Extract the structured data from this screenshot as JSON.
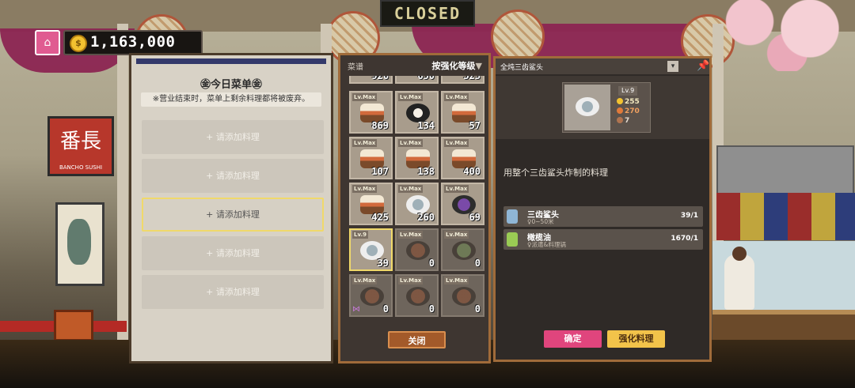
{
  "sign": {
    "text": "CLOSED"
  },
  "shop_sign": {
    "main": "番長",
    "sub": "BANCHO SUSHI"
  },
  "currency": {
    "amount": "1,163,000",
    "coin_symbol": "$",
    "coin_color": "#f2c230"
  },
  "menu": {
    "title": "㊎今日菜单㊎",
    "note": "※营业结束时，菜单上剩余料理都将被废弃。",
    "slots": [
      {
        "label": "+ 请添加料理"
      },
      {
        "label": "+ 请添加料理"
      },
      {
        "label": "+ 请添加料理"
      },
      {
        "label": "+ 请添加料理"
      },
      {
        "label": "+ 请添加料理"
      }
    ]
  },
  "recipes": {
    "header_label": "菜谱",
    "sort_label": "按强化等级",
    "sort_arrow": "▼",
    "close_label": "关闭",
    "partial_counts": [
      "926",
      "650",
      "323"
    ],
    "items": [
      {
        "level": "Lv.Max",
        "count": "869",
        "icon": "sushi-dish-icon",
        "style": "sushi"
      },
      {
        "level": "Lv.Max",
        "count": "134",
        "icon": "roll-dish-icon",
        "style": "roll"
      },
      {
        "level": "Lv.Max",
        "count": "57",
        "icon": "sushi-dish-icon",
        "style": "sushi"
      },
      {
        "level": "Lv.Max",
        "count": "107",
        "icon": "sushi-dish-icon",
        "style": "sushi"
      },
      {
        "level": "Lv.Max",
        "count": "138",
        "icon": "sushi-dish-icon",
        "style": "sushi"
      },
      {
        "level": "Lv.Max",
        "count": "400",
        "icon": "sushi-dish-icon",
        "style": "sushi"
      },
      {
        "level": "Lv.Max",
        "count": "425",
        "icon": "sushi-dish-icon",
        "style": "sushi"
      },
      {
        "level": "Lv.Max",
        "count": "260",
        "icon": "plate-dish-icon",
        "style": "plate"
      },
      {
        "level": "Lv.Max",
        "count": "69",
        "icon": "purple-dish-icon",
        "style": "purple"
      },
      {
        "level": "Lv.9",
        "count": "39",
        "icon": "fried-shark-dish-icon",
        "style": "plate",
        "selected": true
      },
      {
        "level": "Lv.Max",
        "count": "0",
        "icon": "stew-dish-icon",
        "style": "bowl"
      },
      {
        "level": "Lv.Max",
        "count": "0",
        "icon": "soup-dish-icon",
        "style": "green"
      },
      {
        "level": "Lv.Max",
        "count": "0",
        "icon": "fish-dish-icon",
        "style": "bowl"
      },
      {
        "level": "Lv.Max",
        "count": "0",
        "icon": "fish-dish-icon",
        "style": "bowl"
      },
      {
        "level": "Lv.Max",
        "count": "0",
        "icon": "fish-dish-icon",
        "style": "bowl"
      }
    ]
  },
  "detail": {
    "title": "全炖三齿鲨头",
    "level": "Lv.9",
    "stats": [
      {
        "value": "255",
        "color": "#f2c230",
        "icon": "coin-icon"
      },
      {
        "value": "270",
        "color": "#e07a3a",
        "icon": "flavor-icon"
      },
      {
        "value": "7",
        "color": "#b07450",
        "icon": "portion-icon"
      }
    ],
    "description": "用整个三齿鲨头炸制的料理",
    "ingredients": [
      {
        "name": "三齿鲨头",
        "source": "♀0~50米",
        "qty": "39/1",
        "icon": "shark-head-icon",
        "color": "#8fb6d6"
      },
      {
        "name": "橄榄油",
        "source": "♀派遣&料理锅",
        "qty": "1670/1",
        "icon": "olive-oil-icon",
        "color": "#9acb54"
      }
    ],
    "confirm_label": "确定",
    "enhance_label": "强化料理"
  }
}
